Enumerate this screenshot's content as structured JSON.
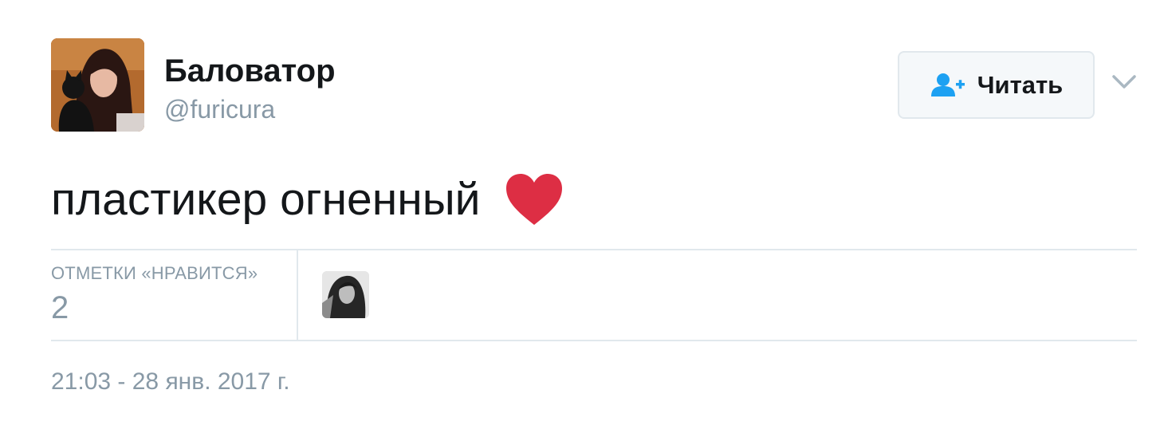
{
  "author": {
    "display_name": "Баловатор",
    "username": "@furicura"
  },
  "follow_button": {
    "label": "Читать",
    "icon": "follow-user-icon"
  },
  "menu": {
    "icon": "chevron-down-icon"
  },
  "tweet": {
    "text": "пластикер огненный",
    "emoji_icon": "heart-icon"
  },
  "stats": {
    "likes_label": "ОТМЕТКИ «НРАВИТСЯ»",
    "likes_count": "2"
  },
  "timestamp": "21:03 - 28 янв. 2017 г.",
  "colors": {
    "text_primary": "#14171a",
    "text_secondary": "#8899a6",
    "divider": "#e1e8ed",
    "accent_blue": "#1da1f2",
    "heart_red": "#e0245e"
  }
}
